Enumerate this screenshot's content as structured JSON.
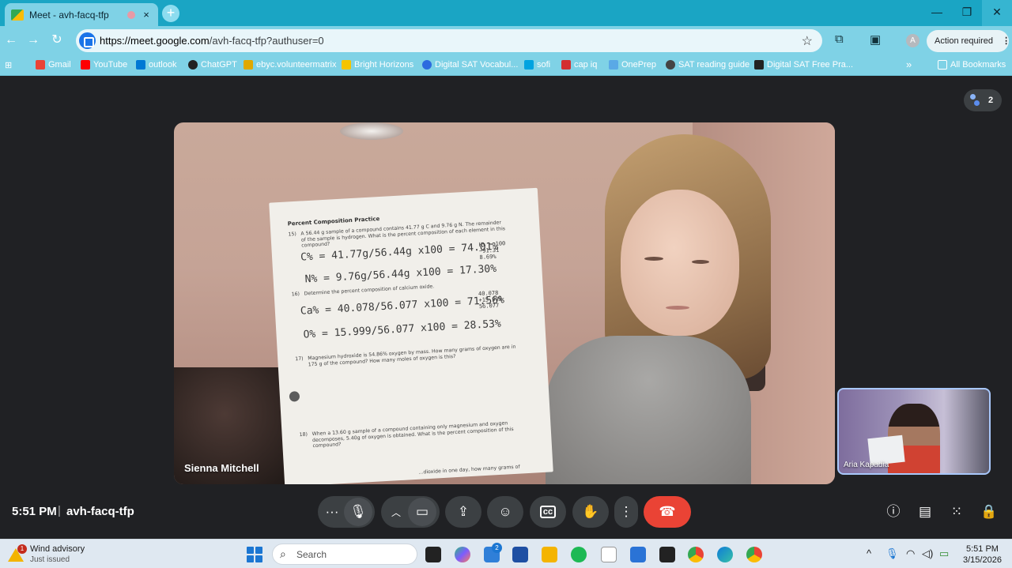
{
  "browser": {
    "tab_title": "Meet - avh-facq-tfp",
    "tab_close": "×",
    "new_tab": "+",
    "window_minimize": "—",
    "window_restore": "❐",
    "window_close": "✕",
    "url_host": "https://meet.google.com",
    "url_path": "/avh-facq-tfp?authuser=0",
    "profile_initial": "A",
    "action_required": "Action required",
    "action_menu": "⋮"
  },
  "bookmarks": [
    {
      "label": "Gmail",
      "color": "#ea4335"
    },
    {
      "label": "YouTube",
      "color": "#ff0000"
    },
    {
      "label": "outlook",
      "color": "#0078d4"
    },
    {
      "label": "ChatGPT",
      "color": "#222222"
    },
    {
      "label": "ebyc.volunteermatrix",
      "color": "#e0a800"
    },
    {
      "label": "Bright Horizons",
      "color": "#f5c400"
    },
    {
      "label": "Digital SAT Vocabul...",
      "color": "#2d6cdf"
    },
    {
      "label": "sofi",
      "color": "#00a3e0"
    },
    {
      "label": "cap iq",
      "color": "#d32f2f"
    },
    {
      "label": "OnePrep",
      "color": "#5aa9e6"
    },
    {
      "label": "SAT reading guide",
      "color": "#444444"
    },
    {
      "label": "Digital SAT Free Pra...",
      "color": "#222222"
    }
  ],
  "bookmarks_overflow": "»",
  "all_bookmarks": "All Bookmarks",
  "meeting": {
    "participant_count": "2",
    "main_participant": "Sienna Mitchell",
    "self_participant": "Aria Kapadia",
    "time": "5:51 PM",
    "separator": "|",
    "code": "avh-facq-tfp"
  },
  "worksheet": {
    "title": "Percent Composition Practice",
    "q15_num": "15)",
    "q15": "A 56.44 g sample of a compound contains 41.77 g C and 9.76 g N. The remainder of the sample is hydrogen. What is the percent composition of each element in this compound?",
    "q16_num": "16)",
    "q16": "Determine the percent composition of calcium oxide.",
    "q17_num": "17)",
    "q17": "Magnesium hydroxide is 54.86% oxygen by mass. How many grams of oxygen are in 175 g of the compound? How many moles of oxygen is this?",
    "q18_num": "18)",
    "q18": "When a 13.60 g sample of a compound containing only magnesium and oxygen decomposes, 5.40g of oxygen is obtained. What is the percent composition of this compound?",
    "hw_c": "C% = 41.77g/56.44g x100 = 74.01%",
    "hw_n": "N% = 9.76g/56.44g x100 = 17.30%",
    "hw_h": "H% = 100 −91.31 8.69%",
    "hw_ca": "Ca% = 40.078/56.077 x100 = 71.56%",
    "hw_ca_side": "40.078 +15.999 56.077",
    "hw_o": "O% = 15.999/56.077 x100 = 28.53%",
    "bottom_fragment": "...dioxide in one day, how many grams of"
  },
  "taskbar": {
    "weather_badge": "1",
    "weather_title": "Wind advisory",
    "weather_sub": "Just issued",
    "search_placeholder": "Search",
    "notification_count": "2",
    "clock_time": "5:51 PM",
    "clock_date": "3/15/2026",
    "tray_chevron": "^"
  }
}
